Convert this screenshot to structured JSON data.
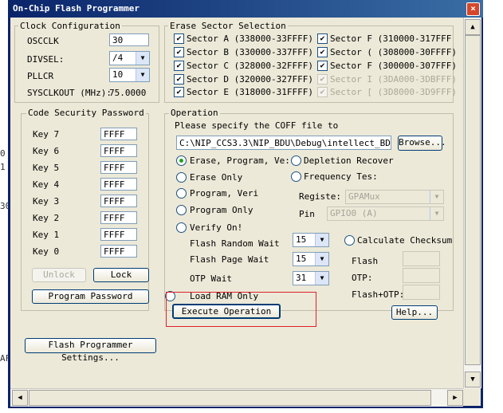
{
  "window": {
    "title": "On-Chip Flash Programmer",
    "close_symbol": "×"
  },
  "clock": {
    "title": "Clock Configuration",
    "osc_label": "OSCCLK",
    "osc_value": "30",
    "divsel_label": "DIVSEL:",
    "divsel_value": "/4",
    "pllcr_label": "PLLCR",
    "pllcr_value": "10",
    "sysclk_label": "SYSCLKOUT (MHz):",
    "sysclk_value": "75.0000"
  },
  "erase": {
    "title": "Erase Sector Selection",
    "sectors": [
      {
        "label": "Sector A (338000-33FFFF)",
        "checked": true
      },
      {
        "label": "Sector B (330000-337FFF)",
        "checked": true
      },
      {
        "label": "Sector C (328000-32FFFF)",
        "checked": true
      },
      {
        "label": "Sector D (320000-327FFF)",
        "checked": true
      },
      {
        "label": "Sector E (318000-31FFFF)",
        "checked": true
      },
      {
        "label": "Sector F (310000-317FFF",
        "checked": true
      },
      {
        "label": "Sector ( (308000-30FFFF)",
        "checked": true
      },
      {
        "label": "Sector F (300000-307FFF)",
        "checked": true
      },
      {
        "label": "Sector I (3DA000-3DBFFF)",
        "checked": true,
        "disabled": true
      },
      {
        "label": "Sector [ (3D8000-3D9FFF)",
        "checked": true,
        "disabled": true
      }
    ]
  },
  "security": {
    "title": "Code Security Password",
    "keys": [
      {
        "label": "Key 7",
        "value": "FFFF"
      },
      {
        "label": "Key 6",
        "value": "FFFF"
      },
      {
        "label": "Key 5",
        "value": "FFFF"
      },
      {
        "label": "Key 4",
        "value": "FFFF"
      },
      {
        "label": "Key 3",
        "value": "FFFF"
      },
      {
        "label": "Key 2",
        "value": "FFFF"
      },
      {
        "label": "Key 1",
        "value": "FFFF"
      },
      {
        "label": "Key 0",
        "value": "FFFF"
      }
    ],
    "unlock_label": "Unlock",
    "lock_label": "Lock",
    "program_password_label": "Program Password"
  },
  "operation": {
    "title": "Operation",
    "coff_prompt": "Please specify the COFF file to",
    "coff_path": "C:\\NIP_CCS3.3\\NIP_BDU\\Debug\\intellect_BDU.out",
    "browse_label": "Browse...",
    "radio_erase_program_verify": "Erase, Program, Ve:",
    "radio_erase_only": "Erase Only",
    "radio_program_verify": "Program, Veri",
    "radio_program_only": "Program Only",
    "radio_verify_only": "Verify On!",
    "radio_depletion": "Depletion Recover",
    "radio_frequency": "Frequency Tes:",
    "register_label": "Registe:",
    "register_value": "GPAMux",
    "pin_label": "Pin",
    "pin_value": "GPIO0 (A)",
    "random_wait_label": "Flash Random Wait",
    "random_wait_value": "15",
    "page_wait_label": "Flash Page Wait",
    "page_wait_value": "15",
    "otp_wait_label": "OTP Wait",
    "otp_wait_value": "31",
    "calc_checksum_label": "Calculate Checksum",
    "flash_label": "Flash",
    "otp_label": "OTP:",
    "flash_otp_label": "Flash+OTP:",
    "load_ram_label": "Load RAM Only",
    "execute_label": "Execute Operation",
    "help_label": "Help..."
  },
  "settings_button_label": "Flash Programmer Settings...",
  "left_clip": [
    "0",
    "1",
    "30",
    "AF"
  ]
}
